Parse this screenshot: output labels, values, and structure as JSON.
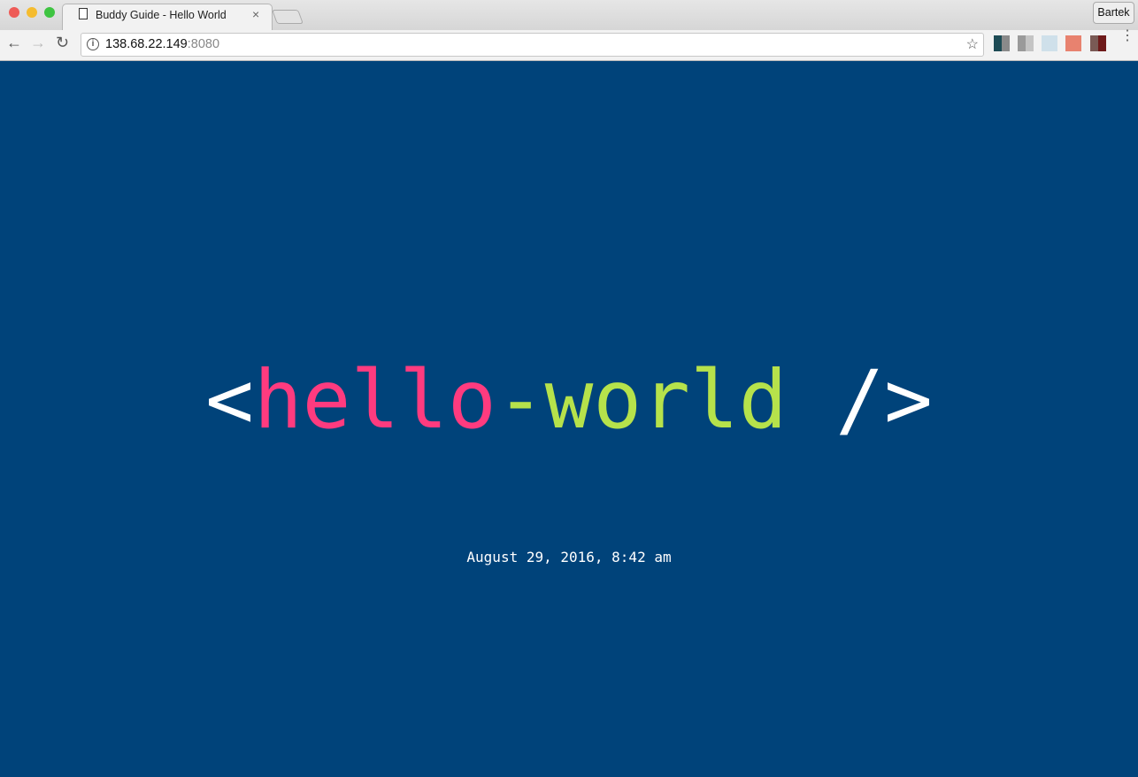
{
  "browser": {
    "tab_title": "Buddy Guide - Hello World",
    "tab_close": "×",
    "profile_name": "Bartek",
    "url_host": "138.68.22.149",
    "url_port": ":8080",
    "back": "←",
    "forward": "→",
    "reload": "↻",
    "star": "☆",
    "info": "i",
    "menu": "⋮"
  },
  "page": {
    "background": "#00437a",
    "headline": {
      "open": "<",
      "word1": "hello",
      "dash": "-",
      "word2": "world",
      "close": " />",
      "color_word1": "#ff3b7f",
      "color_word2": "#b6e24b"
    },
    "date": "August 29, 2016, 8:42 am"
  }
}
